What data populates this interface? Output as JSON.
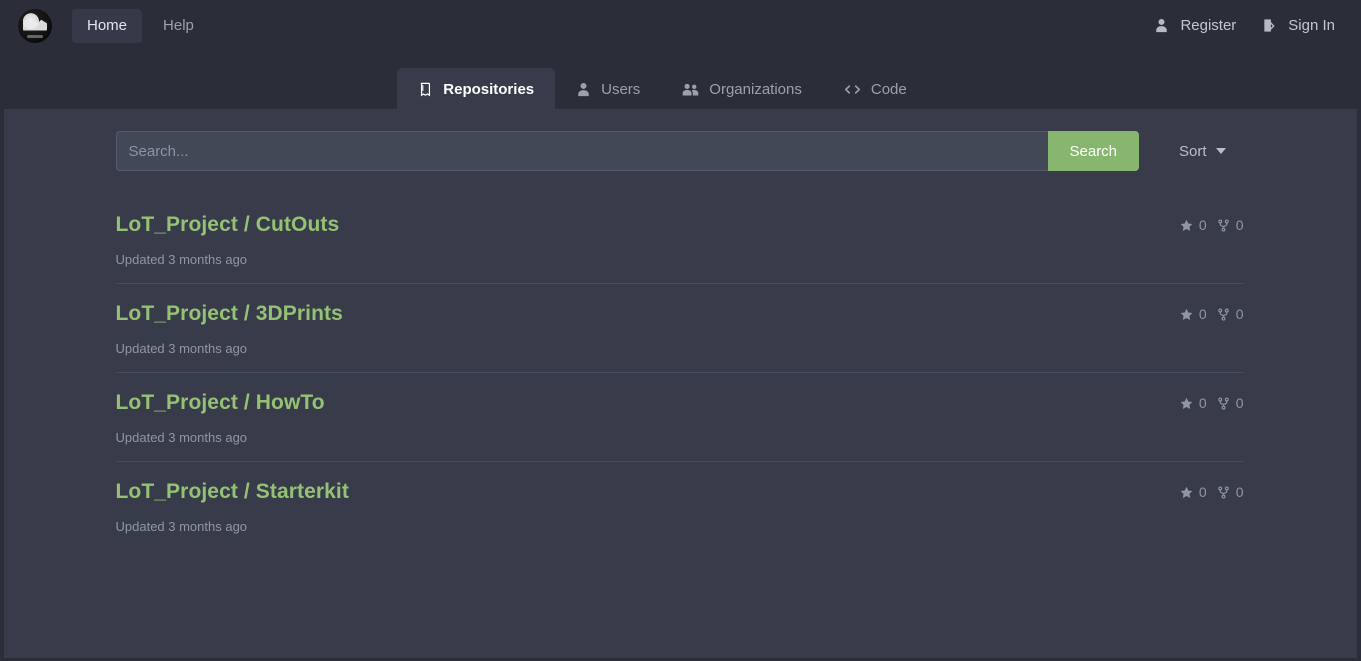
{
  "navbar": {
    "logo_name": "site-logo",
    "links": [
      {
        "label": "Home",
        "active": true
      },
      {
        "label": "Help",
        "active": false
      }
    ],
    "register_label": "Register",
    "register_icon": "user-icon",
    "signin_label": "Sign In",
    "signin_icon": "sign-in-icon"
  },
  "tabs": [
    {
      "label": "Repositories",
      "icon": "book-icon",
      "active": true
    },
    {
      "label": "Users",
      "icon": "user-icon",
      "active": false
    },
    {
      "label": "Organizations",
      "icon": "users-icon",
      "active": false
    },
    {
      "label": "Code",
      "icon": "code-icon",
      "active": false
    }
  ],
  "search": {
    "placeholder": "Search...",
    "value": "",
    "button_label": "Search",
    "sort_label": "Sort",
    "sort_icon": "chevron-down-icon"
  },
  "repositories": [
    {
      "owner": "LoT_Project",
      "name": "CutOuts",
      "full_name": "LoT_Project / CutOuts",
      "updated": "Updated 3 months ago",
      "stars": "0",
      "forks": "0"
    },
    {
      "owner": "LoT_Project",
      "name": "3DPrints",
      "full_name": "LoT_Project / 3DPrints",
      "updated": "Updated 3 months ago",
      "stars": "0",
      "forks": "0"
    },
    {
      "owner": "LoT_Project",
      "name": "HowTo",
      "full_name": "LoT_Project / HowTo",
      "updated": "Updated 3 months ago",
      "stars": "0",
      "forks": "0"
    },
    {
      "owner": "LoT_Project",
      "name": "Starterkit",
      "full_name": "LoT_Project / Starterkit",
      "updated": "Updated 3 months ago",
      "stars": "0",
      "forks": "0"
    }
  ],
  "colors": {
    "navbar_bg": "#2b2e39",
    "page_bg": "#383c4a",
    "accent_green": "#87b76f",
    "repo_link": "#94c174",
    "muted_text": "#9096a4",
    "divider": "#474c5c"
  },
  "icons": {
    "star": "star-icon",
    "fork": "fork-icon"
  }
}
